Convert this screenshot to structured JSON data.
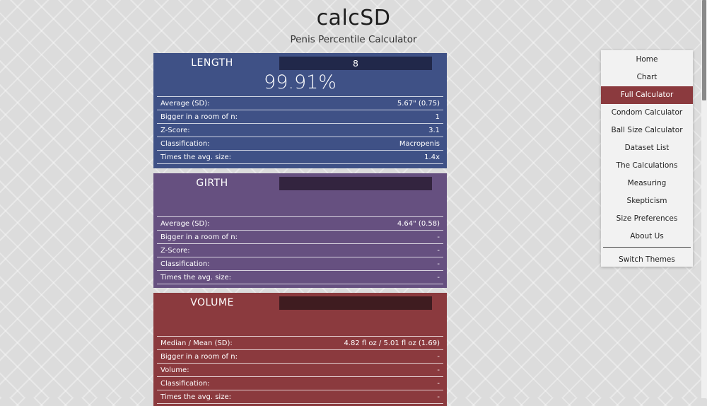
{
  "site": {
    "title": "calcSD",
    "subtitle": "Penis Percentile Calculator"
  },
  "length": {
    "label": "LENGTH",
    "input_value": "8",
    "percentile": "99.91%",
    "rows": [
      {
        "label": "Average (SD):",
        "value": "5.67\" (0.75)"
      },
      {
        "label": "Bigger in a room of n:",
        "value": "1"
      },
      {
        "label": "Z-Score:",
        "value": "3.1"
      },
      {
        "label": "Classification:",
        "value": "Macropenis"
      },
      {
        "label": "Times the avg. size:",
        "value": "1.4x"
      }
    ]
  },
  "girth": {
    "label": "GIRTH",
    "input_value": "",
    "rows": [
      {
        "label": "Average (SD):",
        "value": "4.64\" (0.58)"
      },
      {
        "label": "Bigger in a room of n:",
        "value": "-"
      },
      {
        "label": "Z-Score:",
        "value": "-"
      },
      {
        "label": "Classification:",
        "value": "-"
      },
      {
        "label": "Times the avg. size:",
        "value": "-"
      }
    ]
  },
  "volume": {
    "label": "VOLUME",
    "input_value": "",
    "rows": [
      {
        "label": "Median / Mean (SD):",
        "value": "4.82 fl oz / 5.01 fl oz (1.69)"
      },
      {
        "label": "Bigger in a room of n:",
        "value": "-"
      },
      {
        "label": "Volume:",
        "value": "-"
      },
      {
        "label": "Classification:",
        "value": "-"
      },
      {
        "label": "Times the avg. size:",
        "value": "-"
      }
    ]
  },
  "nav": {
    "items": [
      "Home",
      "Chart",
      "Full Calculator",
      "Condom Calculator",
      "Ball Size Calculator",
      "Dataset List",
      "The Calculations",
      "Measuring",
      "Skepticism",
      "Size Preferences",
      "About Us"
    ],
    "active": "Full Calculator",
    "switch_themes": "Switch Themes"
  },
  "colors": {
    "length_panel": "#3f5186",
    "girth_panel": "#665080",
    "volume_panel": "#8b3a3e",
    "nav_active": "#8b3a3e"
  }
}
